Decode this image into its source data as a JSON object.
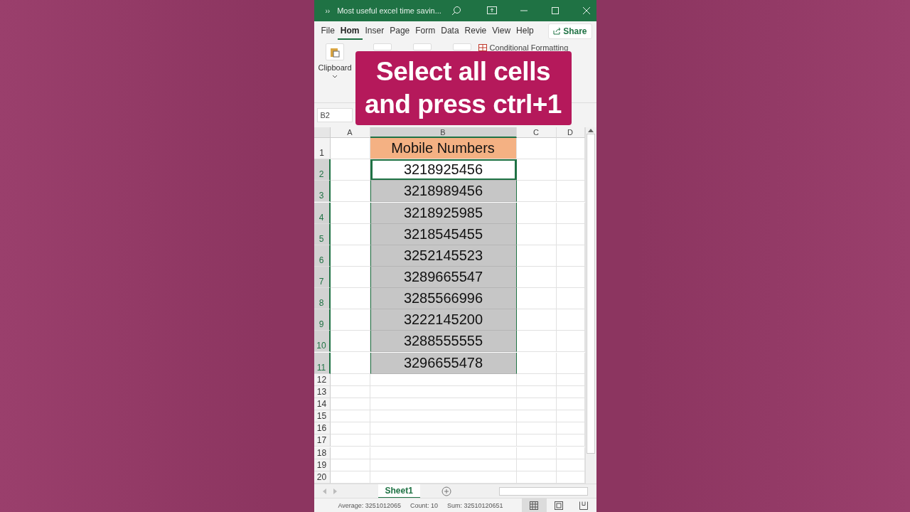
{
  "title_bar": {
    "overflow": "››",
    "title": "Most useful excel time savin..."
  },
  "menu_tabs": [
    {
      "label": "File",
      "selected": false
    },
    {
      "label": "Hom",
      "selected": true
    },
    {
      "label": "Inser",
      "selected": false
    },
    {
      "label": "Page",
      "selected": false
    },
    {
      "label": "Form",
      "selected": false
    },
    {
      "label": "Data",
      "selected": false
    },
    {
      "label": "Revie",
      "selected": false
    },
    {
      "label": "View",
      "selected": false
    },
    {
      "label": "Help",
      "selected": false
    }
  ],
  "share_button": "Share",
  "ribbon": {
    "clipboard_label": "Clipboard",
    "conditional_formatting": "Conditional Formatting"
  },
  "overlay_caption": [
    "Select all cells",
    "and press ctrl+1"
  ],
  "name_box": "B2",
  "columns": [
    {
      "label": "A",
      "selected": false
    },
    {
      "label": "B",
      "selected": true
    },
    {
      "label": "C",
      "selected": false
    },
    {
      "label": "D",
      "selected": false
    }
  ],
  "rows": [
    {
      "number": "1",
      "kind": "header",
      "value": "Mobile Numbers",
      "selected": false,
      "active": false
    },
    {
      "number": "2",
      "kind": "number",
      "value": "3218925456",
      "selected": true,
      "active": true
    },
    {
      "number": "3",
      "kind": "number",
      "value": "3218989456",
      "selected": true,
      "active": false
    },
    {
      "number": "4",
      "kind": "number",
      "value": "3218925985",
      "selected": true,
      "active": false
    },
    {
      "number": "5",
      "kind": "number",
      "value": "3218545455",
      "selected": true,
      "active": false
    },
    {
      "number": "6",
      "kind": "number",
      "value": "3252145523",
      "selected": true,
      "active": false
    },
    {
      "number": "7",
      "kind": "number",
      "value": "3289665547",
      "selected": true,
      "active": false
    },
    {
      "number": "8",
      "kind": "number",
      "value": "3285566996",
      "selected": true,
      "active": false
    },
    {
      "number": "9",
      "kind": "number",
      "value": "3222145200",
      "selected": true,
      "active": false
    },
    {
      "number": "10",
      "kind": "number",
      "value": "3288555555",
      "selected": true,
      "active": false
    },
    {
      "number": "11",
      "kind": "number",
      "value": "3296655478",
      "selected": true,
      "active": false
    },
    {
      "number": "12",
      "kind": "empty",
      "selected": false,
      "active": false
    },
    {
      "number": "13",
      "kind": "empty",
      "selected": false,
      "active": false
    },
    {
      "number": "14",
      "kind": "empty",
      "selected": false,
      "active": false
    },
    {
      "number": "15",
      "kind": "empty",
      "selected": false,
      "active": false
    },
    {
      "number": "16",
      "kind": "empty",
      "selected": false,
      "active": false
    },
    {
      "number": "17",
      "kind": "empty",
      "selected": false,
      "active": false
    },
    {
      "number": "18",
      "kind": "empty",
      "selected": false,
      "active": false
    },
    {
      "number": "19",
      "kind": "empty",
      "selected": false,
      "active": false
    },
    {
      "number": "20",
      "kind": "empty",
      "selected": false,
      "active": false
    }
  ],
  "sheet_tabs": [
    {
      "label": "Sheet1",
      "selected": true
    }
  ],
  "status_bar": {
    "readings": [
      "Average: 3251012065",
      "Count: 10",
      "Sum: 32510120651"
    ],
    "views": [
      {
        "kind": "normal",
        "selected": true
      },
      {
        "kind": "layout",
        "selected": false
      },
      {
        "kind": "break",
        "selected": false
      }
    ]
  }
}
